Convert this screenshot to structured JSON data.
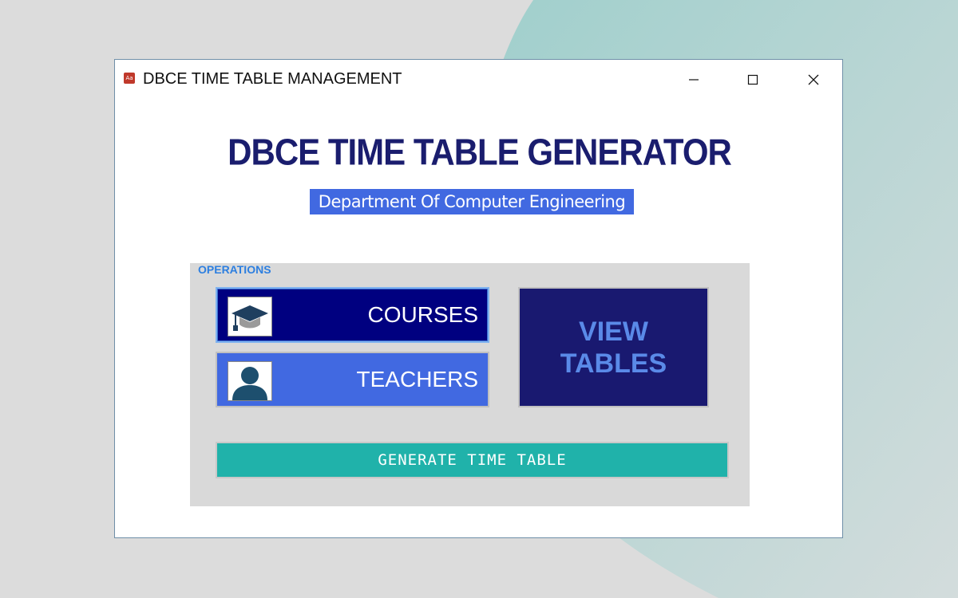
{
  "window": {
    "title": "DBCE TIME TABLE MANAGEMENT",
    "app_icon_text": "Aa",
    "controls": [
      "minimize-icon",
      "maximize-icon",
      "close-icon"
    ]
  },
  "header": {
    "title": "DBCE TIME TABLE GENERATOR",
    "subtitle": "Department Of Computer Engineering"
  },
  "operations": {
    "label": "OPERATIONS",
    "courses_label": "COURSES",
    "courses_icon": "graduation-cap-icon",
    "teachers_label": "TEACHERS",
    "teachers_icon": "user-icon",
    "view_tables_line1": "VIEW",
    "view_tables_line2": "TABLES",
    "generate_label": "GENERATE TIME TABLE"
  },
  "colors": {
    "title": "#1a1d6e",
    "subtitle_bg": "#4169e1",
    "courses_bg": "#000080",
    "teachers_bg": "#4169e1",
    "view_bg": "#191970",
    "view_text": "#5a8ae8",
    "generate_bg": "#20b2aa",
    "ops_label": "#2d7fe0",
    "panel_bg": "#d9d9d9"
  }
}
